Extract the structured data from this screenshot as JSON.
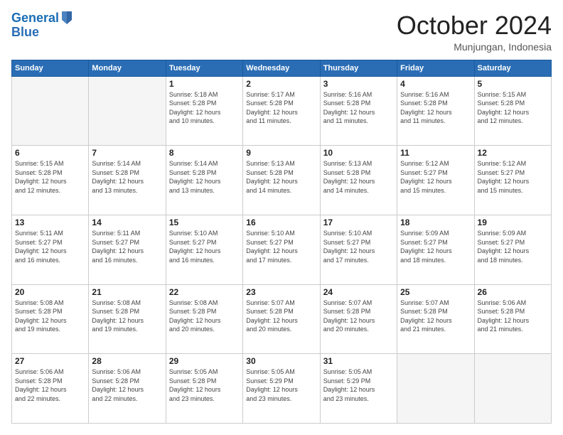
{
  "logo": {
    "line1": "General",
    "line2": "Blue"
  },
  "header": {
    "month": "October 2024",
    "location": "Munjungan, Indonesia"
  },
  "weekdays": [
    "Sunday",
    "Monday",
    "Tuesday",
    "Wednesday",
    "Thursday",
    "Friday",
    "Saturday"
  ],
  "weeks": [
    [
      {
        "day": "",
        "info": ""
      },
      {
        "day": "",
        "info": ""
      },
      {
        "day": "1",
        "info": "Sunrise: 5:18 AM\nSunset: 5:28 PM\nDaylight: 12 hours\nand 10 minutes."
      },
      {
        "day": "2",
        "info": "Sunrise: 5:17 AM\nSunset: 5:28 PM\nDaylight: 12 hours\nand 11 minutes."
      },
      {
        "day": "3",
        "info": "Sunrise: 5:16 AM\nSunset: 5:28 PM\nDaylight: 12 hours\nand 11 minutes."
      },
      {
        "day": "4",
        "info": "Sunrise: 5:16 AM\nSunset: 5:28 PM\nDaylight: 12 hours\nand 11 minutes."
      },
      {
        "day": "5",
        "info": "Sunrise: 5:15 AM\nSunset: 5:28 PM\nDaylight: 12 hours\nand 12 minutes."
      }
    ],
    [
      {
        "day": "6",
        "info": "Sunrise: 5:15 AM\nSunset: 5:28 PM\nDaylight: 12 hours\nand 12 minutes."
      },
      {
        "day": "7",
        "info": "Sunrise: 5:14 AM\nSunset: 5:28 PM\nDaylight: 12 hours\nand 13 minutes."
      },
      {
        "day": "8",
        "info": "Sunrise: 5:14 AM\nSunset: 5:28 PM\nDaylight: 12 hours\nand 13 minutes."
      },
      {
        "day": "9",
        "info": "Sunrise: 5:13 AM\nSunset: 5:28 PM\nDaylight: 12 hours\nand 14 minutes."
      },
      {
        "day": "10",
        "info": "Sunrise: 5:13 AM\nSunset: 5:28 PM\nDaylight: 12 hours\nand 14 minutes."
      },
      {
        "day": "11",
        "info": "Sunrise: 5:12 AM\nSunset: 5:27 PM\nDaylight: 12 hours\nand 15 minutes."
      },
      {
        "day": "12",
        "info": "Sunrise: 5:12 AM\nSunset: 5:27 PM\nDaylight: 12 hours\nand 15 minutes."
      }
    ],
    [
      {
        "day": "13",
        "info": "Sunrise: 5:11 AM\nSunset: 5:27 PM\nDaylight: 12 hours\nand 16 minutes."
      },
      {
        "day": "14",
        "info": "Sunrise: 5:11 AM\nSunset: 5:27 PM\nDaylight: 12 hours\nand 16 minutes."
      },
      {
        "day": "15",
        "info": "Sunrise: 5:10 AM\nSunset: 5:27 PM\nDaylight: 12 hours\nand 16 minutes."
      },
      {
        "day": "16",
        "info": "Sunrise: 5:10 AM\nSunset: 5:27 PM\nDaylight: 12 hours\nand 17 minutes."
      },
      {
        "day": "17",
        "info": "Sunrise: 5:10 AM\nSunset: 5:27 PM\nDaylight: 12 hours\nand 17 minutes."
      },
      {
        "day": "18",
        "info": "Sunrise: 5:09 AM\nSunset: 5:27 PM\nDaylight: 12 hours\nand 18 minutes."
      },
      {
        "day": "19",
        "info": "Sunrise: 5:09 AM\nSunset: 5:27 PM\nDaylight: 12 hours\nand 18 minutes."
      }
    ],
    [
      {
        "day": "20",
        "info": "Sunrise: 5:08 AM\nSunset: 5:28 PM\nDaylight: 12 hours\nand 19 minutes."
      },
      {
        "day": "21",
        "info": "Sunrise: 5:08 AM\nSunset: 5:28 PM\nDaylight: 12 hours\nand 19 minutes."
      },
      {
        "day": "22",
        "info": "Sunrise: 5:08 AM\nSunset: 5:28 PM\nDaylight: 12 hours\nand 20 minutes."
      },
      {
        "day": "23",
        "info": "Sunrise: 5:07 AM\nSunset: 5:28 PM\nDaylight: 12 hours\nand 20 minutes."
      },
      {
        "day": "24",
        "info": "Sunrise: 5:07 AM\nSunset: 5:28 PM\nDaylight: 12 hours\nand 20 minutes."
      },
      {
        "day": "25",
        "info": "Sunrise: 5:07 AM\nSunset: 5:28 PM\nDaylight: 12 hours\nand 21 minutes."
      },
      {
        "day": "26",
        "info": "Sunrise: 5:06 AM\nSunset: 5:28 PM\nDaylight: 12 hours\nand 21 minutes."
      }
    ],
    [
      {
        "day": "27",
        "info": "Sunrise: 5:06 AM\nSunset: 5:28 PM\nDaylight: 12 hours\nand 22 minutes."
      },
      {
        "day": "28",
        "info": "Sunrise: 5:06 AM\nSunset: 5:28 PM\nDaylight: 12 hours\nand 22 minutes."
      },
      {
        "day": "29",
        "info": "Sunrise: 5:05 AM\nSunset: 5:28 PM\nDaylight: 12 hours\nand 23 minutes."
      },
      {
        "day": "30",
        "info": "Sunrise: 5:05 AM\nSunset: 5:29 PM\nDaylight: 12 hours\nand 23 minutes."
      },
      {
        "day": "31",
        "info": "Sunrise: 5:05 AM\nSunset: 5:29 PM\nDaylight: 12 hours\nand 23 minutes."
      },
      {
        "day": "",
        "info": ""
      },
      {
        "day": "",
        "info": ""
      }
    ]
  ]
}
